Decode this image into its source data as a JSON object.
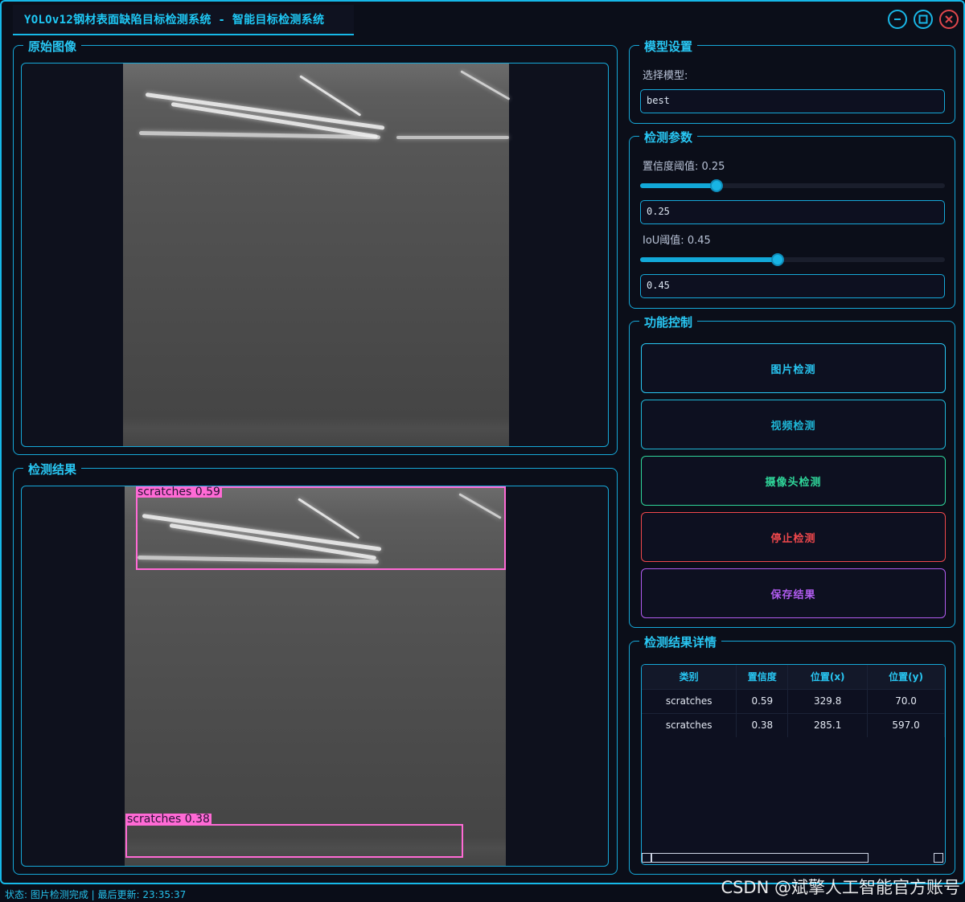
{
  "window": {
    "title": "YOLOv12钢材表面缺陷目标检测系统 - 智能目标检测系统",
    "minimize_icon": "minimize-icon",
    "maximize_icon": "maximize-icon",
    "close_icon": "close-icon"
  },
  "original_panel": {
    "title": "原始图像"
  },
  "result_panel": {
    "title": "检测结果",
    "detections": [
      {
        "label": "scratches 0.59"
      },
      {
        "label": "scratches 0.38"
      }
    ]
  },
  "model_settings": {
    "title": "模型设置",
    "select_label": "选择模型:",
    "selected_model": "best"
  },
  "params": {
    "title": "检测参数",
    "conf_label": "置信度阈值: 0.25",
    "conf_value": "0.25",
    "conf_fraction": 0.25,
    "iou_label": "IoU阈值: 0.45",
    "iou_value": "0.45",
    "iou_fraction": 0.45
  },
  "controls": {
    "title": "功能控制",
    "buttons": [
      {
        "label": "图片检测",
        "color": "#28c6f2"
      },
      {
        "label": "视频检测",
        "color": "#1fb6d6"
      },
      {
        "label": "摄像头检测",
        "color": "#2fd69a"
      },
      {
        "label": "停止检测",
        "color": "#f0484c"
      },
      {
        "label": "保存结果",
        "color": "#b15cf0"
      }
    ]
  },
  "details": {
    "title": "检测结果详情",
    "columns": [
      "类别",
      "置信度",
      "位置(x)",
      "位置(y)"
    ],
    "rows": [
      [
        "scratches",
        "0.59",
        "329.8",
        "70.0"
      ],
      [
        "scratches",
        "0.38",
        "285.1",
        "597.0"
      ]
    ]
  },
  "status": "状态: 图片检测完成 | 最后更新: 23:35:37",
  "watermark": "CSDN @斌擎人工智能官方账号"
}
